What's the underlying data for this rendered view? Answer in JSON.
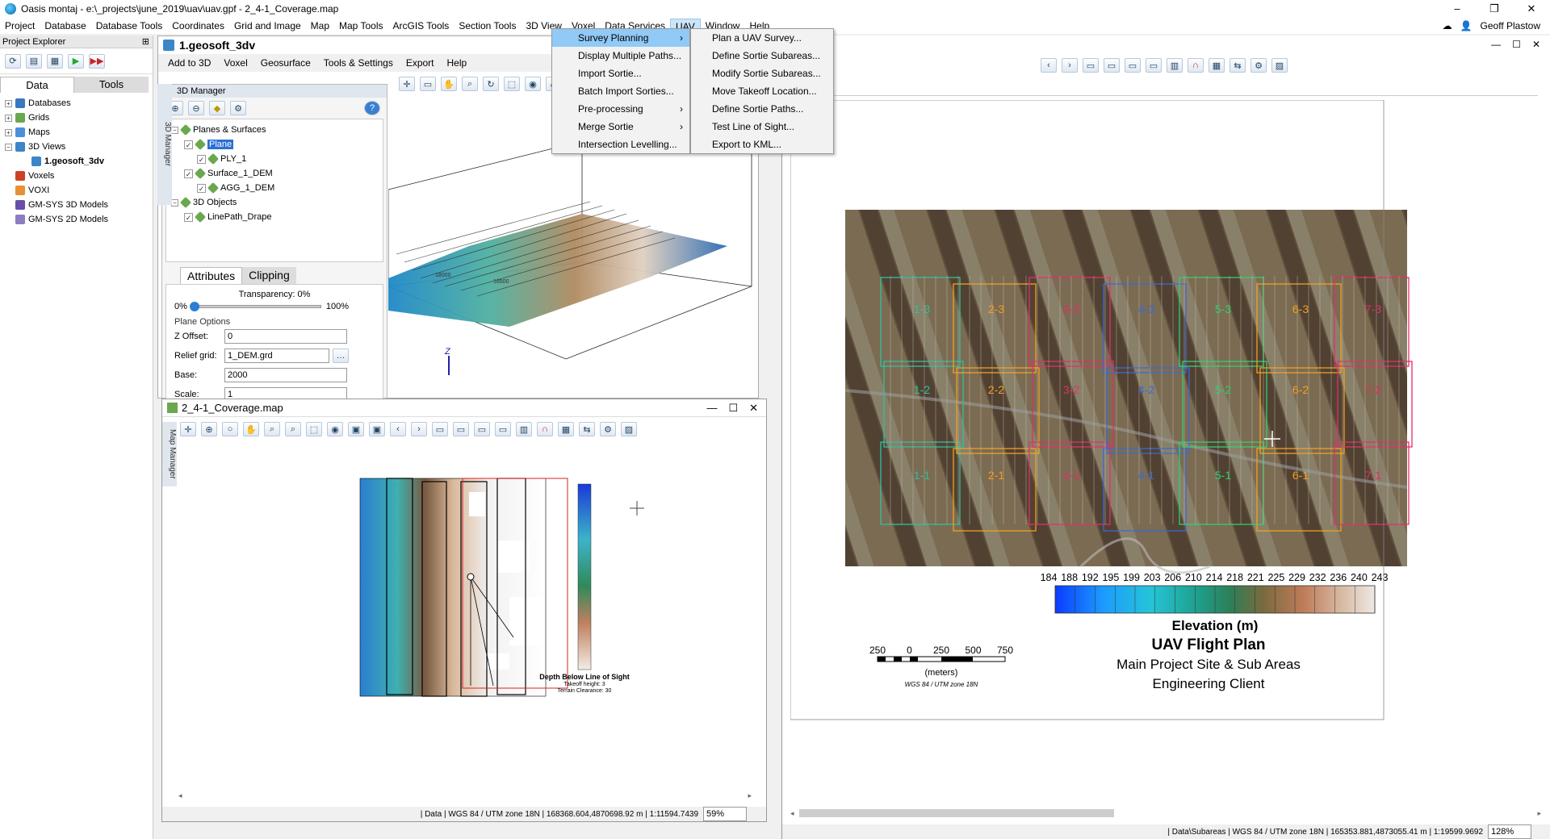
{
  "titlebar": {
    "title": "Oasis montaj - e:\\_projects\\june_2019\\uav\\uav.gpf - 2_4-1_Coverage.map",
    "controls": [
      "–",
      "❐",
      "✕"
    ]
  },
  "menubar": {
    "items": [
      "Project",
      "Database",
      "Database Tools",
      "Coordinates",
      "Grid and Image",
      "Map",
      "Map Tools",
      "ArcGIS Tools",
      "Section Tools",
      "3D View",
      "Voxel",
      "Data Services",
      "UAV",
      "Window",
      "Help"
    ],
    "active": "UAV",
    "user": "Geoff Plastow"
  },
  "explorer": {
    "title": "Project Explorer",
    "pin": "⊞",
    "tabs": [
      "Data",
      "Tools"
    ],
    "tree": [
      {
        "label": "Databases",
        "level": 0,
        "color": "#3a78c2"
      },
      {
        "label": "Grids",
        "level": 0,
        "color": "#6aa84f"
      },
      {
        "label": "Maps",
        "level": 0,
        "color": "#4a90d9"
      },
      {
        "label": "3D Views",
        "level": 0,
        "color": "#3d85c6"
      },
      {
        "label": "1.geosoft_3dv",
        "level": 1,
        "color": "#3d85c6",
        "bold": true
      },
      {
        "label": "Voxels",
        "level": 0,
        "color": "#cc4125"
      },
      {
        "label": "VOXI",
        "level": 0,
        "color": "#e69138"
      },
      {
        "label": "GM-SYS 3D Models",
        "level": 0,
        "color": "#674ea7"
      },
      {
        "label": "GM-SYS 2D Models",
        "level": 0,
        "color": "#8e7cc3"
      }
    ]
  },
  "doc3d": {
    "title": "1.geosoft_3dv",
    "menu": [
      "Add to 3D",
      "Voxel",
      "Geosurface",
      "Tools & Settings",
      "Export",
      "Help"
    ]
  },
  "manager3d": {
    "title": "3D Manager",
    "side_tab": "3D Manager",
    "tree": [
      {
        "label": "Planes & Surfaces",
        "level": 0
      },
      {
        "label": "Plane",
        "level": 1,
        "selected": true
      },
      {
        "label": "PLY_1",
        "level": 2
      },
      {
        "label": "Surface_1_DEM",
        "level": 1
      },
      {
        "label": "AGG_1_DEM",
        "level": 2
      },
      {
        "label": "3D Objects",
        "level": 0
      },
      {
        "label": "LinePath_Drape",
        "level": 1
      }
    ],
    "attr_tabs": [
      "Attributes",
      "Clipping"
    ],
    "transparency_label": "Transparency: 0%",
    "transparency_min": "0%",
    "transparency_max": "100%",
    "plane_options": "Plane Options",
    "fields": [
      {
        "label": "Z Offset:",
        "value": "0"
      },
      {
        "label": "Relief grid:",
        "value": "1_DEM.grd"
      },
      {
        "label": "Base:",
        "value": "2000"
      },
      {
        "label": "Scale:",
        "value": "1"
      }
    ],
    "help": "?"
  },
  "mapsmall": {
    "title": "2_4-1_Coverage.map",
    "side_tab": "Map Manager",
    "legend_title": "Depth Below Line of Sight",
    "legend_sub1": "Takeoff height: 3",
    "legend_sub2": "Terrain Clearance: 30",
    "status": "| Data  |  WGS 84 / UTM zone 18N  |  168368.604,4870698.92 m  |  1:11594.7439",
    "zoom": "59%"
  },
  "bigmap": {
    "status": "| Data\\Subareas  |  WGS 84 / UTM zone 18N  |  165353.881,4873055.41 m  |  1:19599.9692",
    "zoom": "128%",
    "grid_labels": [
      "1-3",
      "2-3",
      "3-3",
      "4-3",
      "5-3",
      "6-3",
      "7-3",
      "1-2",
      "2-2",
      "3-2",
      "4-2",
      "5-2",
      "6-2",
      "7-2",
      "1-1",
      "2-1",
      "3-1",
      "4-1",
      "5-1",
      "6-1",
      "7-1"
    ],
    "colorbar_ticks": [
      "184",
      "188",
      "192",
      "195",
      "199",
      "203",
      "206",
      "210",
      "214",
      "218",
      "221",
      "225",
      "229",
      "232",
      "236",
      "240",
      "243"
    ],
    "colorbar_title": "Elevation (m)",
    "scalebar_ticks": [
      "250",
      "0",
      "250",
      "500",
      "750"
    ],
    "scalebar_unit": "(meters)",
    "projection": "WGS 84 / UTM zone 18N",
    "title1": "UAV Flight Plan",
    "title2": "Main Project Site & Sub Areas",
    "title3": "Engineering Client"
  },
  "uav_menu": {
    "items": [
      {
        "label": "Survey Planning",
        "sub": true,
        "highlight": true
      },
      {
        "label": "Display Multiple Paths..."
      },
      {
        "label": "Import Sortie..."
      },
      {
        "label": "Batch Import Sorties..."
      },
      {
        "label": "Pre-processing",
        "sub": true
      },
      {
        "label": "Merge Sortie",
        "sub": true
      },
      {
        "label": "Intersection Levelling..."
      }
    ]
  },
  "survey_menu": {
    "items": [
      "Plan a UAV Survey...",
      "Define Sortie Subareas...",
      "Modify Sortie Subareas...",
      "Move Takeoff Location...",
      "Define Sortie Paths...",
      "Test Line of Sight...",
      "Export to KML..."
    ]
  }
}
